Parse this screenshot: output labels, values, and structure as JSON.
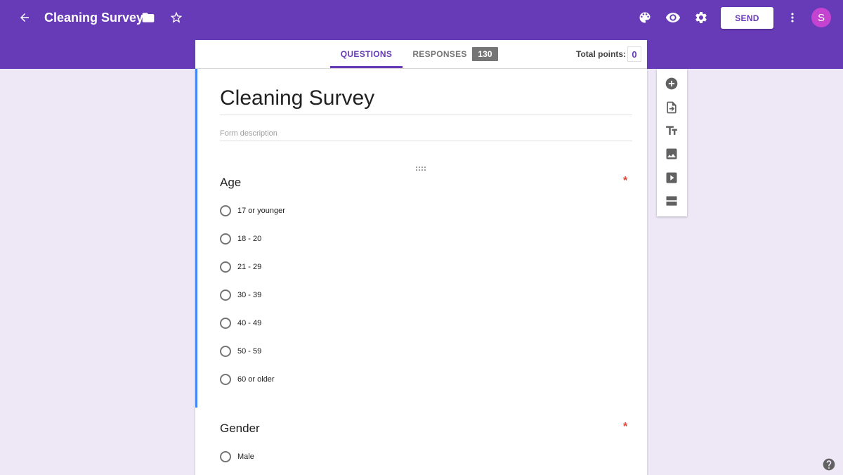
{
  "app": {
    "title": "Cleaning Survey",
    "avatar_letter": "S",
    "send_label": "SEND",
    "accent_color": "#673ab7",
    "background_color": "#ede7f6"
  },
  "icons": {
    "back": "arrow-back-icon",
    "folder": "folder-icon",
    "star": "star-outline-icon",
    "palette": "palette-icon",
    "preview": "eye-icon",
    "settings": "gear-icon",
    "more": "more-vertical-icon",
    "help": "help-icon"
  },
  "tabs": {
    "questions_label": "QUESTIONS",
    "responses_label": "RESPONSES",
    "responses_count": "130",
    "active": "QUESTIONS"
  },
  "points": {
    "label": "Total points:",
    "value": "0"
  },
  "form": {
    "title": "Cleaning Survey",
    "description_placeholder": "Form description",
    "questions": [
      {
        "title": "Age",
        "required_mark": "*",
        "options": [
          "17 or younger",
          "18 - 20",
          "21 - 29",
          "30 - 39",
          "40 - 49",
          "50 - 59",
          "60 or older"
        ]
      },
      {
        "title": "Gender",
        "required_mark": "*",
        "options": [
          "Male"
        ]
      }
    ]
  },
  "side_toolbar": {
    "tools": [
      "add-question-icon",
      "import-questions-icon",
      "add-title-icon",
      "add-image-icon",
      "add-video-icon",
      "add-section-icon"
    ]
  }
}
